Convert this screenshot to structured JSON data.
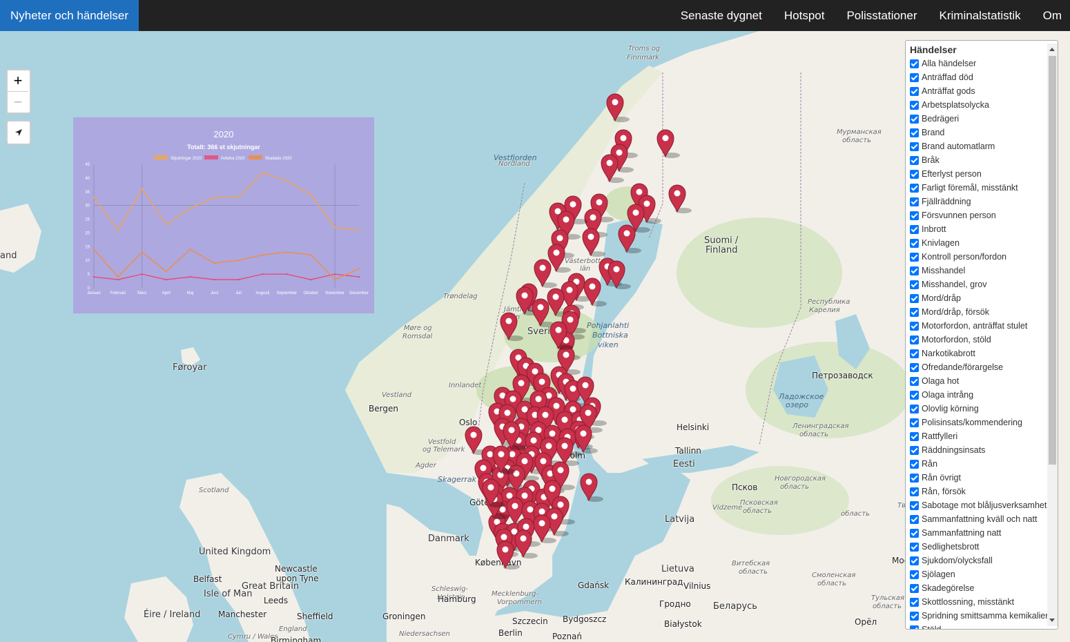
{
  "navbar": {
    "brand": "Nyheter och händelser",
    "links": [
      "Senaste dygnet",
      "Hotspot",
      "Polisstationer",
      "Kriminalstatistik",
      "Om"
    ]
  },
  "map": {
    "labels": [
      {
        "text": "Troms og",
        "cls": "region"
      },
      {
        "text": "Finnmark",
        "cls": "region"
      },
      {
        "text": "Vestfjorden",
        "cls": "sea"
      },
      {
        "text": "Nordland",
        "cls": "region"
      },
      {
        "text": "Мурманская",
        "cls": "region"
      },
      {
        "text": "область",
        "cls": "region"
      },
      {
        "text": "Suomi /",
        "cls": "country"
      },
      {
        "text": "Finland",
        "cls": "country"
      },
      {
        "text": "Västerbottens",
        "cls": "region"
      },
      {
        "text": "län",
        "cls": "region"
      },
      {
        "text": "Trøndelag",
        "cls": "region"
      },
      {
        "text": "Jämtlands",
        "cls": "region"
      },
      {
        "text": "län",
        "cls": "region"
      },
      {
        "text": "Sverige",
        "cls": "country"
      },
      {
        "text": "Pohjanlahti",
        "cls": "sea"
      },
      {
        "text": "Bottniska",
        "cls": "sea"
      },
      {
        "text": "viken",
        "cls": "sea"
      },
      {
        "text": "Møre og",
        "cls": "region"
      },
      {
        "text": "Romsdal",
        "cls": "region"
      },
      {
        "text": "Республика",
        "cls": "region"
      },
      {
        "text": "Карелия",
        "cls": "region"
      },
      {
        "text": "Føroyar",
        "cls": "country"
      },
      {
        "text": "Innlandet",
        "cls": "region"
      },
      {
        "text": "Vestland",
        "cls": "region"
      },
      {
        "text": "Bergen",
        "cls": "city"
      },
      {
        "text": "Oslo",
        "cls": "city"
      },
      {
        "text": "Петрозаводск",
        "cls": "city"
      },
      {
        "text": "Ладожское",
        "cls": "sea"
      },
      {
        "text": "озеро",
        "cls": "sea"
      },
      {
        "text": "Helsinki",
        "cls": "city"
      },
      {
        "text": "Ленинградская",
        "cls": "region"
      },
      {
        "text": "область",
        "cls": "region"
      },
      {
        "text": "Vestfold",
        "cls": "region"
      },
      {
        "text": "og Telemark",
        "cls": "region"
      },
      {
        "text": "Tallinn",
        "cls": "city"
      },
      {
        "text": "Agder",
        "cls": "region"
      },
      {
        "text": "Eesti",
        "cls": "country"
      },
      {
        "text": "Skagerrak",
        "cls": "sea"
      },
      {
        "text": "Псков",
        "cls": "city"
      },
      {
        "text": "Новгородская",
        "cls": "region"
      },
      {
        "text": "область",
        "cls": "region"
      },
      {
        "text": "Scotland",
        "cls": "region"
      },
      {
        "text": "Göte",
        "cls": "city"
      },
      {
        "text": "Vidzeme",
        "cls": "region"
      },
      {
        "text": "Псковская",
        "cls": "region"
      },
      {
        "text": "область",
        "cls": "region"
      },
      {
        "text": "Тверская",
        "cls": "region"
      },
      {
        "text": "область",
        "cls": "region"
      },
      {
        "text": "Latvija",
        "cls": "country"
      },
      {
        "text": "Danmark",
        "cls": "country"
      },
      {
        "text": "United Kingdom",
        "cls": "country"
      },
      {
        "text": "Витебская",
        "cls": "region"
      },
      {
        "text": "область",
        "cls": "region"
      },
      {
        "text": "Москва",
        "cls": "city"
      },
      {
        "text": "Newcastle",
        "cls": "city"
      },
      {
        "text": "upon Tyne",
        "cls": "city"
      },
      {
        "text": "København",
        "cls": "city"
      },
      {
        "text": "Lietuva",
        "cls": "country"
      },
      {
        "text": "Смоленская",
        "cls": "region"
      },
      {
        "text": "область",
        "cls": "region"
      },
      {
        "text": "Belfast",
        "cls": "city"
      },
      {
        "text": "Great Britain",
        "cls": "country"
      },
      {
        "text": "Gdańsk",
        "cls": "city"
      },
      {
        "text": "Калининград",
        "cls": "city"
      },
      {
        "text": "Vilnius",
        "cls": "city"
      },
      {
        "text": "Isle of Man",
        "cls": "country"
      },
      {
        "text": "Leeds",
        "cls": "city"
      },
      {
        "text": "Schleswig-",
        "cls": "region"
      },
      {
        "text": "Holstein",
        "cls": "region"
      },
      {
        "text": "Mecklenburg-",
        "cls": "region"
      },
      {
        "text": "Vorpommern",
        "cls": "region"
      },
      {
        "text": "Hamburg",
        "cls": "city"
      },
      {
        "text": "Гродно",
        "cls": "city"
      },
      {
        "text": "Беларусь",
        "cls": "country"
      },
      {
        "text": "Тульская",
        "cls": "region"
      },
      {
        "text": "область",
        "cls": "region"
      },
      {
        "text": "Éire / Ireland",
        "cls": "country"
      },
      {
        "text": "Manchester",
        "cls": "city"
      },
      {
        "text": "Sheffield",
        "cls": "city"
      },
      {
        "text": "Groningen",
        "cls": "city"
      },
      {
        "text": "Szczecin",
        "cls": "city"
      },
      {
        "text": "Bydgoszcz",
        "cls": "city"
      },
      {
        "text": "Białystok",
        "cls": "city"
      },
      {
        "text": "Орёл",
        "cls": "city"
      },
      {
        "text": "England",
        "cls": "region"
      },
      {
        "text": "Niedersachsen",
        "cls": "region"
      },
      {
        "text": "Berlin",
        "cls": "city"
      },
      {
        "text": "Poznań",
        "cls": "city"
      },
      {
        "text": "Cymru / Wales",
        "cls": "region"
      },
      {
        "text": "Birmingham",
        "cls": "city"
      },
      {
        "text": "and",
        "cls": "country"
      },
      {
        "text": "holm",
        "cls": "city"
      }
    ]
  },
  "controls": {
    "zoom_in": "+",
    "zoom_out": "−"
  },
  "chart_data": {
    "type": "line",
    "title": "2020",
    "subtitle": "Totalt: 366 st skjutningar",
    "categories": [
      "Januari",
      "Februari",
      "Mars",
      "April",
      "Maj",
      "Juni",
      "Juli",
      "Augusti",
      "September",
      "Oktober",
      "November",
      "December"
    ],
    "series": [
      {
        "name": "Skjutningar 2020",
        "color": "#f5a640",
        "values": [
          33,
          21,
          36,
          23,
          29,
          33,
          33,
          42,
          39,
          34,
          22,
          21
        ]
      },
      {
        "name": "Avlidna 2020",
        "color": "#e8466e",
        "values": [
          4,
          3,
          5,
          3,
          4,
          3,
          3,
          5,
          5,
          3,
          5,
          4
        ]
      },
      {
        "name": "Skadade 2020",
        "color": "#f58a3a",
        "values": [
          14,
          4,
          13,
          6,
          14,
          9,
          10,
          12,
          13,
          12,
          3,
          7
        ]
      }
    ],
    "yticks": [
      0,
      5,
      10,
      15,
      20,
      25,
      30,
      35,
      40,
      45
    ],
    "ylim": [
      0,
      45
    ]
  },
  "panel": {
    "title": "Händelser",
    "items": [
      "Alla händelser",
      "Anträffad död",
      "Anträffat gods",
      "Arbetsplatsolycka",
      "Bedrägeri",
      "Brand",
      "Brand automatlarm",
      "Bråk",
      "Efterlyst person",
      "Farligt föremål, misstänkt",
      "Fjällräddning",
      "Försvunnen person",
      "Inbrott",
      "Knivlagen",
      "Kontroll person/fordon",
      "Misshandel",
      "Misshandel, grov",
      "Mord/dråp",
      "Mord/dråp, försök",
      "Motorfordon, anträffat stulet",
      "Motorfordon, stöld",
      "Narkotikabrott",
      "Ofredande/förargelse",
      "Olaga hot",
      "Olaga intrång",
      "Olovlig körning",
      "Polisinsats/kommendering",
      "Rattfylleri",
      "Räddningsinsats",
      "Rån",
      "Rån övrigt",
      "Rån, försök",
      "Sabotage mot blåljusverksamhet",
      "Sammanfattning kväll och natt",
      "Sammanfattning natt",
      "Sedlighetsbrott",
      "Sjukdom/olycksfall",
      "Sjölagen",
      "Skadegörelse",
      "Skottlossning, misstänkt",
      "Spridning smittsamma kemikalier",
      "Stöld"
    ]
  },
  "colors": {
    "navbar_bg": "#222222",
    "brand_bg": "#1f6fbf",
    "marker": "#c9304a",
    "water": "#aad3df",
    "land": "#f2efe9",
    "forest": "#c8dfb0"
  }
}
